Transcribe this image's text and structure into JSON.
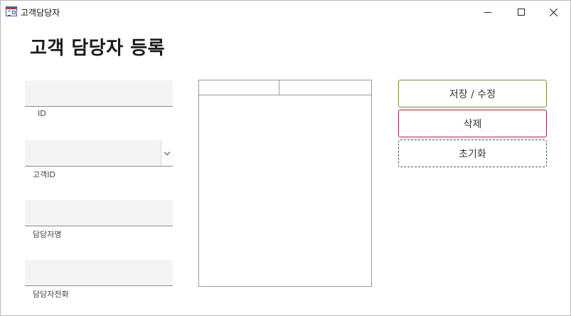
{
  "window": {
    "title": "고객담당자"
  },
  "page": {
    "title": "고객 담당자 등록"
  },
  "form": {
    "fields": [
      {
        "key": "id",
        "label": "ID",
        "value": ""
      },
      {
        "key": "customer_id",
        "label": "고객ID",
        "value": ""
      },
      {
        "key": "contact_name",
        "label": "담당자명",
        "value": ""
      },
      {
        "key": "contact_phone",
        "label": "담당자전화",
        "value": ""
      }
    ]
  },
  "list": {
    "columns": [
      "",
      ""
    ],
    "rows": []
  },
  "actions": {
    "save_label": "저장 / 수정",
    "delete_label": "삭제",
    "reset_label": "초기화"
  },
  "colors": {
    "save_border": "#7a8a3a",
    "delete_border": "#b0203a",
    "reset_border": "#1f5c8c",
    "field_background": "#f4f4f4"
  },
  "icons": [
    "app-form-icon",
    "minimize-icon",
    "maximize-icon",
    "close-icon",
    "chevron-down-icon"
  ]
}
